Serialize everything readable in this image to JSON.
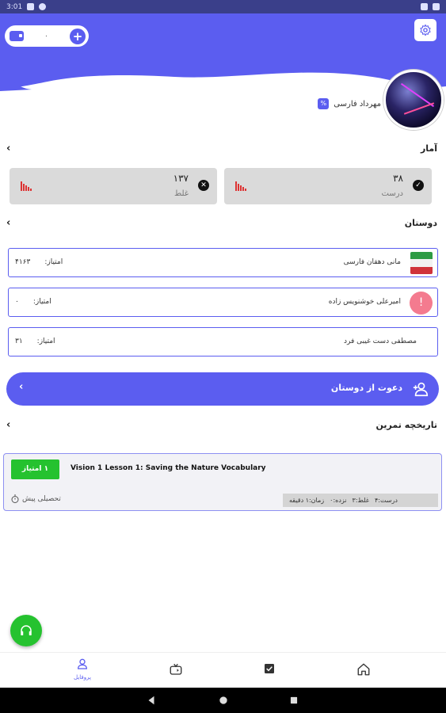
{
  "status_bar": {
    "time": "3:01"
  },
  "wallet": {
    "value": "۰",
    "add_label": "+"
  },
  "user": {
    "name": "مهرداد فارسی",
    "badge": "%"
  },
  "stats": {
    "title": "آمار",
    "correct": {
      "value": "۳۸",
      "label": "درست"
    },
    "wrong": {
      "value": "۱۳۷",
      "label": "غلط"
    }
  },
  "friends": {
    "title": "دوستان",
    "score_label": "امتیاز:",
    "items": [
      {
        "name": "مانی دهقان فارسی",
        "score": "۴۱۶۳"
      },
      {
        "name": "امیرعلی خوشنویس زاده",
        "score": "۰"
      },
      {
        "name": "مصطفی دست غیبی فرد",
        "score": "۳۱"
      }
    ]
  },
  "invite": {
    "label": "دعوت از دوستان"
  },
  "history": {
    "title": "تاریخچه تمرین",
    "item": {
      "badge": "۱ امتیاز",
      "title": "Vision 1 Lesson 1: Saving the Nature Vocabulary",
      "level": "تحصیلی پیش",
      "stats": {
        "correct": "درست:۴",
        "wrong": "غلط:۳",
        "skipped": "نزده:۰",
        "time": "زمان:۱ دقیقه"
      }
    }
  },
  "bottom_nav": {
    "profile_label": "پروفایل"
  },
  "colors": {
    "primary": "#5b5df0",
    "green": "#25c22f",
    "card_gray": "#dadada",
    "alert": "#f47b8f"
  }
}
